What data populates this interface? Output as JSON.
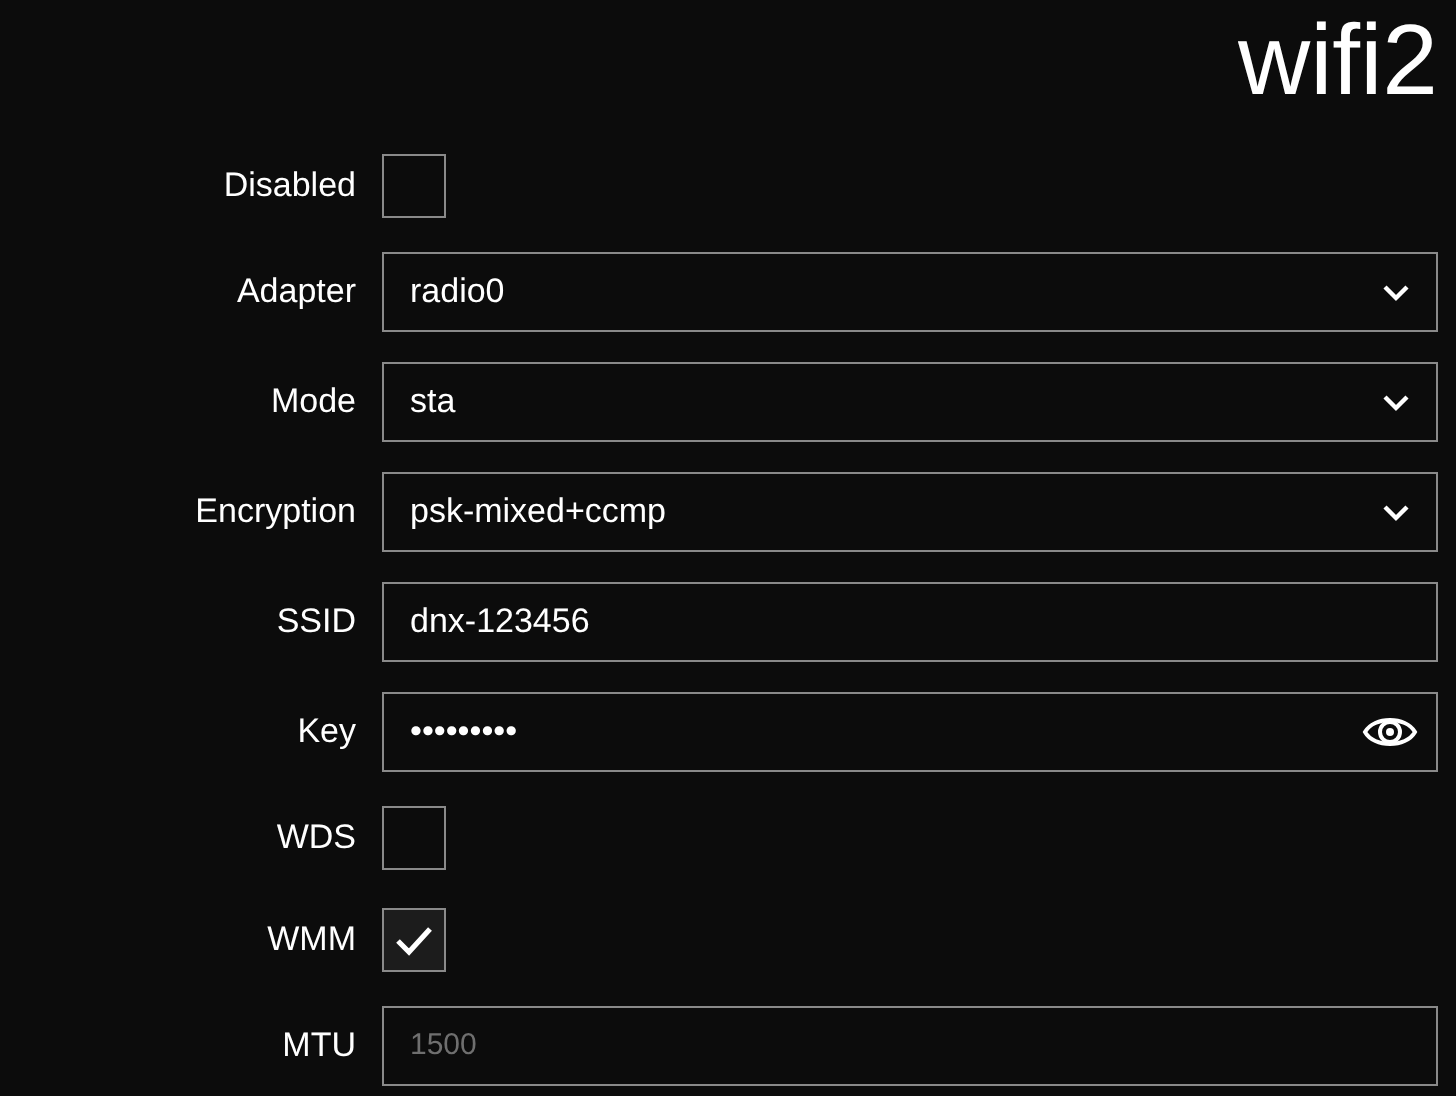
{
  "title": "wifi2",
  "fields": [
    {
      "label": "Disabled",
      "kind": "checkbox",
      "checked": false
    },
    {
      "label": "Adapter",
      "kind": "select",
      "value": "radio0"
    },
    {
      "label": "Mode",
      "kind": "select",
      "value": "sta"
    },
    {
      "label": "Encryption",
      "kind": "select",
      "value": "psk-mixed+ccmp"
    },
    {
      "label": "SSID",
      "kind": "text",
      "value": "dnx-123456"
    },
    {
      "label": "Key",
      "kind": "password",
      "value": "•••••••••"
    },
    {
      "label": "WDS",
      "kind": "checkbox",
      "checked": false
    },
    {
      "label": "WMM",
      "kind": "checkbox",
      "checked": true
    },
    {
      "label": "MTU",
      "kind": "text",
      "placeholder": "1500"
    }
  ]
}
